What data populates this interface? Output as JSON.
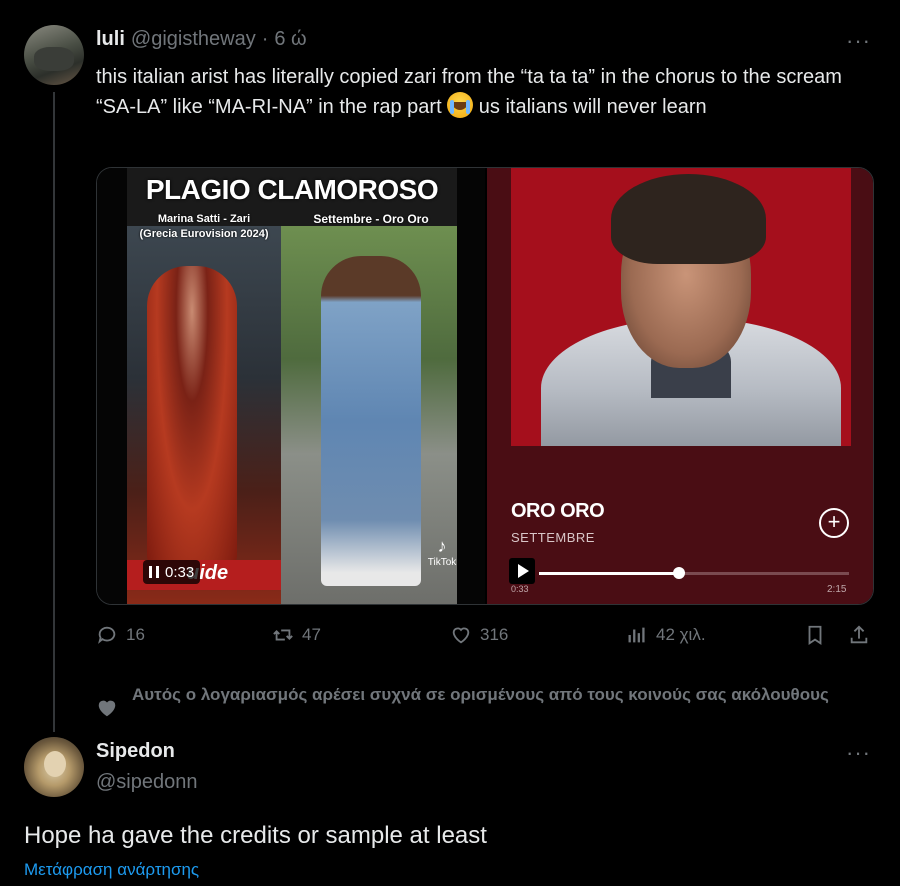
{
  "tweet": {
    "author_name": "luli",
    "author_handle": "@gigistheway",
    "separator": "·",
    "time": "6 ώ",
    "text_before_emoji": "this italian arist has literally copied zari from the “ta ta ta” in the chorus to the scream “SA-LA” like “MA-RI-NA” in the rap part ",
    "text_after_emoji": " us italians will never learn",
    "emoji": "loudly-crying-face-emoji"
  },
  "video": {
    "title": "PLAGIO CLAMOROSO",
    "left_caption_line1": "Marina Satti - Zari",
    "left_caption_line2": "(Grecia Eurovision 2024)",
    "right_caption": "Settembre - Oro Oro",
    "timestamp": "0:33",
    "overlay_text": "uide",
    "tiktok_label": "TikTok"
  },
  "music_card": {
    "track_title": "ORO ORO",
    "artist": "SETTEMBRE",
    "current_time": "0:33",
    "duration": "2:15",
    "progress_fraction": 0.45
  },
  "actions": {
    "replies": "16",
    "retweets": "47",
    "likes": "316",
    "views": "42 χιλ."
  },
  "social_context": "Αυτός ο λογαριασμός αρέσει συχνά σε ορισμένους από τους κοινούς σας ακόλουθους",
  "reply": {
    "author_name": "Sipedon",
    "author_handle": "@sipedonn",
    "text": "Hope ha gave the credits or sample at least",
    "translate_link": "Μετάφραση ανάρτησης"
  },
  "colors": {
    "background": "#000000",
    "text": "#e7e9ea",
    "muted": "#71767b",
    "link": "#1d9bf0",
    "card_bg": "#4a0d14",
    "cover_red": "#a50f1c"
  }
}
